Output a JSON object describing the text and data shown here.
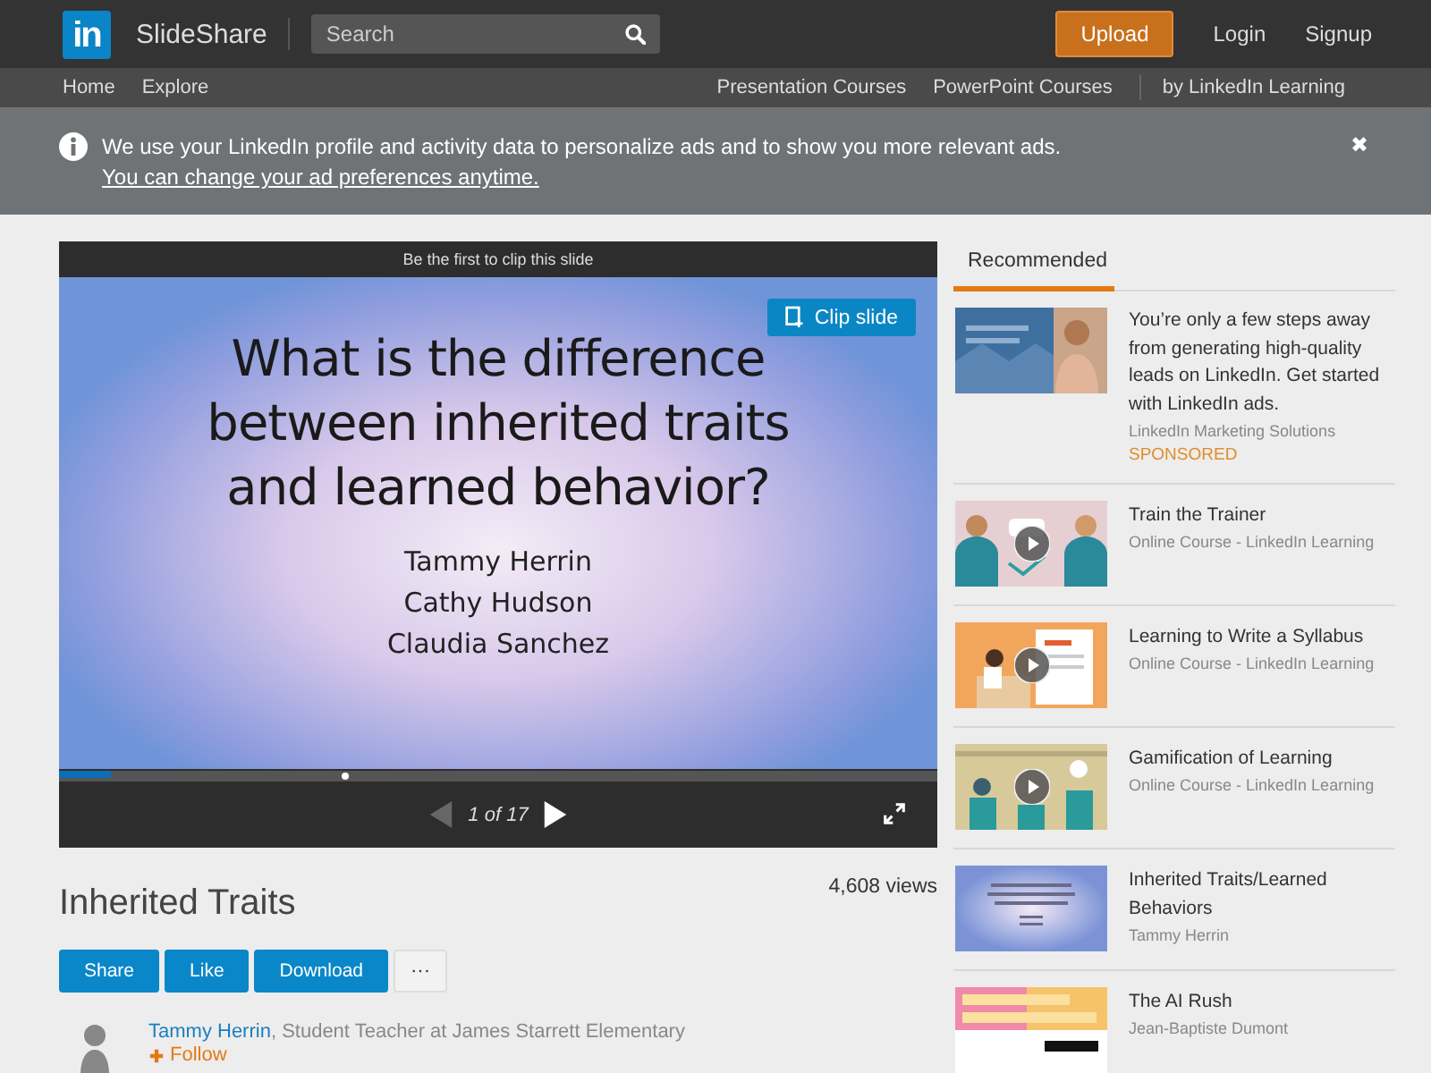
{
  "header": {
    "logo": "in",
    "brand": "SlideShare",
    "search": {
      "placeholder": "Search"
    },
    "upload": "Upload",
    "links": [
      "Login",
      "Signup"
    ]
  },
  "nav": {
    "left": [
      "Home",
      "Explore"
    ],
    "right": [
      "Presentation Courses",
      "PowerPoint Courses",
      "by LinkedIn Learning"
    ]
  },
  "notice": {
    "text": "We use your LinkedIn profile and activity data to personalize ads and to show you more relevant ads.",
    "link": "You can change your ad preferences anytime.",
    "close": "✖"
  },
  "player": {
    "clip_prompt": "Be the first to clip this slide",
    "clip_button": "Clip slide",
    "slide": {
      "title_lines": [
        "What is the difference",
        "between inherited traits",
        "and learned behavior?"
      ],
      "authors": [
        "Tammy Herrin",
        "Cathy Hudson",
        "Claudia Sanchez"
      ]
    },
    "progress": {
      "level": 0.06
    },
    "prev_disabled": true,
    "page_indicator": "1 of 17"
  },
  "presentation": {
    "title": "Inherited Traits",
    "views": "4,608 views",
    "actions": [
      "Share",
      "Like",
      "Download"
    ],
    "more": "···",
    "author": {
      "name": "Tammy Herrin",
      "role": ", Student Teacher at James Starrett Elementary",
      "follow": "Follow"
    }
  },
  "sidebar": {
    "tab": "Recommended",
    "items": [
      {
        "kind": "ad",
        "title": "You’re only a few steps away from generating high-quality leads on LinkedIn. Get started with LinkedIn ads.",
        "source": "LinkedIn Marketing Solutions",
        "badge": "SPONSORED"
      },
      {
        "kind": "course",
        "title": "Train the Trainer",
        "source": "Online Course - LinkedIn Learning"
      },
      {
        "kind": "course",
        "title": "Learning to Write a Syllabus",
        "source": "Online Course - LinkedIn Learning"
      },
      {
        "kind": "course",
        "title": "Gamification of Learning",
        "source": "Online Course - LinkedIn Learning"
      },
      {
        "kind": "slides",
        "title": "Inherited Traits/Learned Behaviors",
        "source": "Tammy Herrin"
      },
      {
        "kind": "slides",
        "title": "The AI Rush",
        "source": "Jean-Baptiste Dumont"
      }
    ]
  }
}
